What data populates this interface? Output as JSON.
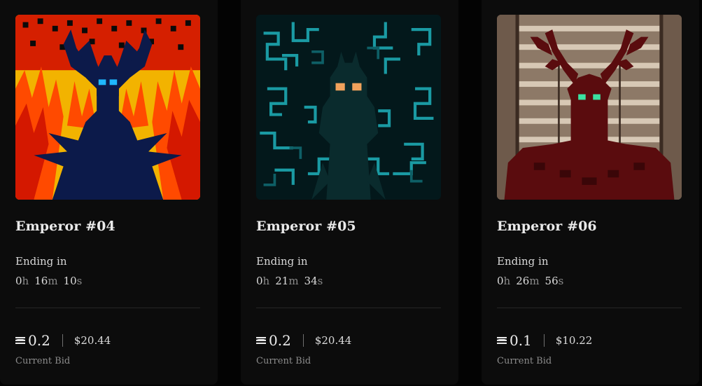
{
  "cards": [
    {
      "title": "Emperor #04",
      "ending_label": "Ending in",
      "timer": {
        "h": "0",
        "h_unit": "h",
        "m": "16",
        "m_unit": "m",
        "s": "10",
        "s_unit": "s"
      },
      "eth_value": "0.2",
      "usd_value": "$20.44",
      "bid_label": "Current Bid",
      "art": {
        "theme": "fire",
        "bg": "#f4b800",
        "accent": "#e62c00",
        "figure": "#0c1a4a",
        "eyes": "#1db5ff"
      }
    },
    {
      "title": "Emperor #05",
      "ending_label": "Ending in",
      "timer": {
        "h": "0",
        "h_unit": "h",
        "m": "21",
        "m_unit": "m",
        "s": "34",
        "s_unit": "s"
      },
      "eth_value": "0.2",
      "usd_value": "$20.44",
      "bid_label": "Current Bid",
      "art": {
        "theme": "teal-roots",
        "bg": "#031a1d",
        "accent": "#1aa3ac",
        "figure": "#0b2c2e",
        "eyes": "#f2a55c"
      }
    },
    {
      "title": "Emperor #06",
      "ending_label": "Ending in",
      "timer": {
        "h": "0",
        "h_unit": "h",
        "m": "26",
        "m_unit": "m",
        "s": "56",
        "s_unit": "s"
      },
      "eth_value": "0.1",
      "usd_value": "$10.22",
      "bid_label": "Current Bid",
      "art": {
        "theme": "antlers",
        "bg": "#8a7663",
        "accent": "#d9cbb8",
        "figure": "#5a0a0c",
        "eyes": "#39e0a0"
      }
    }
  ]
}
